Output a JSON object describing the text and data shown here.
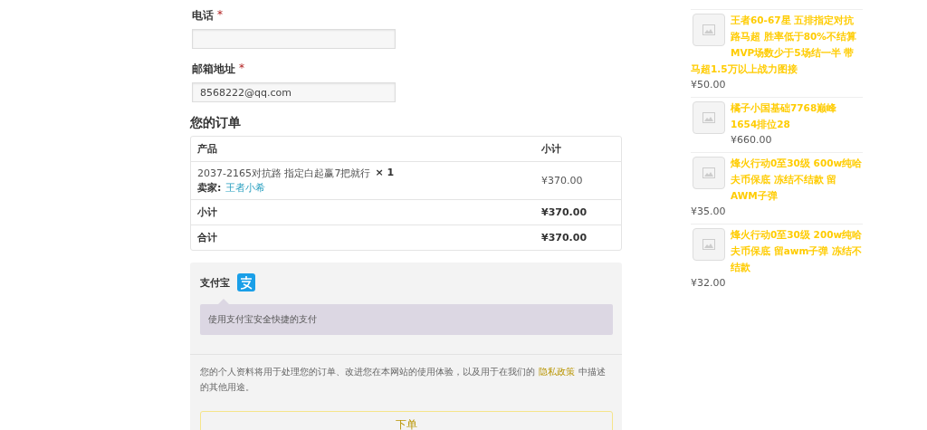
{
  "checkout_form": {
    "fields": [
      {
        "label": "电话",
        "required_mark": "*"
      },
      {
        "label": "邮箱地址",
        "required_mark": "*",
        "value": "8568222@qq.com"
      }
    ]
  },
  "order": {
    "heading": "您的订单",
    "columns": [
      "产品",
      "小计"
    ],
    "items": [
      {
        "product": "2037-2165对抗路 指定白起赢7把就行",
        "quantity": "× 1",
        "seller_label": "卖家:",
        "seller": "王者小希",
        "subtotal": "¥370.00"
      }
    ],
    "totals": [
      {
        "label": "小计",
        "amount": "¥370.00"
      },
      {
        "label": "合计",
        "amount": "¥370.00"
      }
    ]
  },
  "payment": {
    "method": "支付宝",
    "description": "使用支付宝安全快捷的支付",
    "privacy_before": "您的个人资料将用于处理您的订单、改进您在本网站的使用体验，以及用于在我们的",
    "privacy_link": "隐私政策",
    "privacy_after": "中描述的其他用途。",
    "submit": "下单"
  },
  "sidebar_products": [
    {
      "title": "王者60-67星 五排指定对抗路马超 胜率低于80%不结算MVP场数少于5场结一半 带马超1.5万以上战力图接",
      "price": "¥50.00"
    },
    {
      "title": "橘子小国基础7768巅峰1654排位28",
      "price": "¥660.00"
    },
    {
      "title": "烽火行动0至30级 600w纯哈夫币保底 冻结不结款 留AWM子弹",
      "price": "¥35.00"
    },
    {
      "title": "烽火行动0至30级 200w纯哈夫币保底 留awm子弹 冻结不结款",
      "price": "¥32.00"
    }
  ]
}
